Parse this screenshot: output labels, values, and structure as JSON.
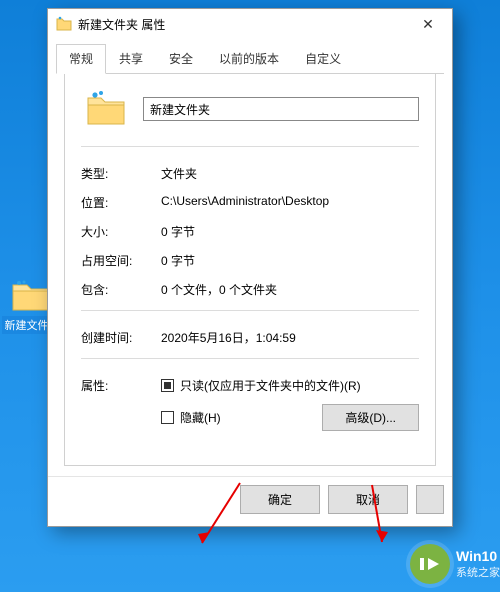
{
  "desktop": {
    "icon_label": "新建文件夹"
  },
  "dialog": {
    "title": "新建文件夹 属性",
    "tabs": [
      {
        "label": "常规"
      },
      {
        "label": "共享"
      },
      {
        "label": "安全"
      },
      {
        "label": "以前的版本"
      },
      {
        "label": "自定义"
      }
    ],
    "active_tab": 0,
    "name_value": "新建文件夹",
    "fields": {
      "type_label": "类型:",
      "type_value": "文件夹",
      "location_label": "位置:",
      "location_value": "C:\\Users\\Administrator\\Desktop",
      "size_label": "大小:",
      "size_value": "0 字节",
      "ondisk_label": "占用空间:",
      "ondisk_value": "0 字节",
      "contains_label": "包含:",
      "contains_value": "0 个文件，0 个文件夹",
      "created_label": "创建时间:",
      "created_value": "2020年5月16日，1:04:59"
    },
    "attributes": {
      "label": "属性:",
      "readonly_label": "只读(仅应用于文件夹中的文件)(R)",
      "hidden_label": "隐藏(H)",
      "advanced_label": "高级(D)..."
    },
    "buttons": {
      "ok": "确定",
      "cancel": "取消",
      "apply": ""
    }
  },
  "watermark": {
    "logo_text": "I▶",
    "line1": "Win10",
    "line2": "系统之家"
  }
}
